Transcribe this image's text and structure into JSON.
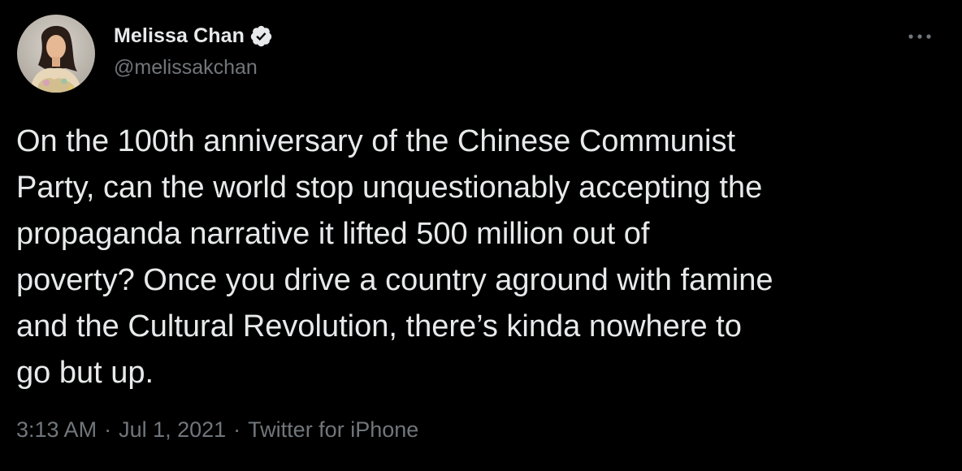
{
  "author": {
    "display_name": "Melissa Chan",
    "handle": "@melissakchan",
    "verified_icon": "verified-badge-icon",
    "avatar_icon": "profile-photo"
  },
  "menu": {
    "more_icon": "more-dots-icon"
  },
  "tweet": {
    "lines": [
      "On the 100th anniversary of the Chinese Communist",
      "Party, can the world stop unquestionably accepting the",
      "propaganda narrative it lifted 500 million out of",
      "poverty? Once you drive a country aground with famine",
      "and the Cultural Revolution, there’s kinda nowhere to",
      "go but up."
    ]
  },
  "meta": {
    "time": "3:13 AM",
    "separator": "·",
    "date": "Jul 1, 2021",
    "source": "Twitter for iPhone"
  },
  "colors": {
    "background": "#000000",
    "text_primary": "#e7e9ea",
    "text_secondary": "#71767b",
    "verified": "#e7e9ea"
  }
}
